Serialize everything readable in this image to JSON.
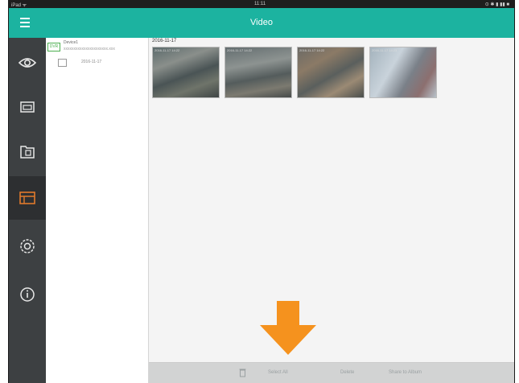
{
  "status_bar": {
    "left": "iPad ᯤ",
    "time": "11:11",
    "right": "⊙ ✱ ▮ ▮▮ ■"
  },
  "header": {
    "title": "Video"
  },
  "sidebar": {
    "items": [
      {
        "icon": "eye-icon",
        "label": ""
      },
      {
        "icon": "playback-icon",
        "label": ""
      },
      {
        "icon": "folder-icon",
        "label": ""
      },
      {
        "icon": "video-files-icon",
        "label": "",
        "active": true
      },
      {
        "icon": "settings-icon",
        "label": ""
      },
      {
        "icon": "info-icon",
        "label": ""
      }
    ]
  },
  "device_tree": {
    "device_badge": "DVR",
    "device_name": "Device1",
    "device_sub": "xxxxxxxxxxxxxxxxxxxxxx.xxx",
    "date_item": "2016-11-17"
  },
  "content": {
    "date_header": "2016-11-17",
    "thumbnails": [
      {
        "caption": "2016-11-17 14:22"
      },
      {
        "caption": "2016-11-17 14:22"
      },
      {
        "caption": "2016-11-17 14:22"
      },
      {
        "caption": "2016-11-17 14:23"
      }
    ]
  },
  "bottom_bar": {
    "select_all": "Select All",
    "delete": "Delete",
    "share": "Share to Album"
  },
  "colors": {
    "accent": "#1cb3a0",
    "sidebar": "#3d4042",
    "arrow": "#f5921e",
    "active_icon": "#e07a2c"
  }
}
